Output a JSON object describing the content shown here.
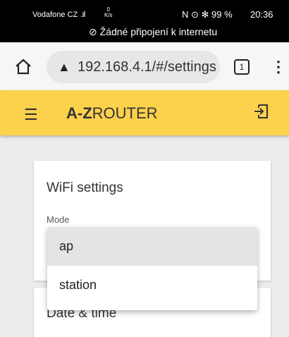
{
  "status_bar": {
    "carrier": "Vodafone CZ",
    "signal": ".ıl",
    "speed_value": "0",
    "speed_unit": "K/s",
    "indicators": "N ⊙ ✻ 99 %",
    "time": "20:36",
    "no_connection": "Žádné připojení k internetu"
  },
  "browser": {
    "url": "192.168.4.1/#/settings",
    "tab_count": "1"
  },
  "appbar": {
    "brand_prefix": "A-Z",
    "brand_suffix": "ROUTER"
  },
  "wifi_card": {
    "title": "WiFi settings",
    "mode_label": "Mode"
  },
  "date_card": {
    "title": "Date & time"
  },
  "dropdown": {
    "options": [
      "ap",
      "station"
    ],
    "selected": "ap"
  },
  "colors": {
    "appbar": "#fcd14c",
    "selected_option": "#e4e4e4"
  }
}
